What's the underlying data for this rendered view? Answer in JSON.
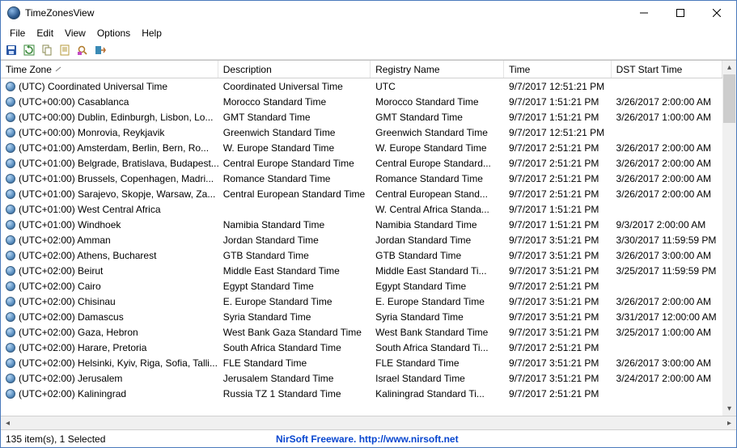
{
  "window": {
    "title": "TimeZonesView"
  },
  "menus": [
    "File",
    "Edit",
    "View",
    "Options",
    "Help"
  ],
  "columns": {
    "tz": "Time Zone",
    "desc": "Description",
    "reg": "Registry Name",
    "time": "Time",
    "dst": "DST Start Time",
    "sort_caret": "∠"
  },
  "rows": [
    {
      "tz": "(UTC) Coordinated Universal Time",
      "desc": "Coordinated Universal Time",
      "reg": "UTC",
      "time": "9/7/2017 12:51:21 PM",
      "dst": ""
    },
    {
      "tz": "(UTC+00:00) Casablanca",
      "desc": "Morocco Standard Time",
      "reg": "Morocco Standard Time",
      "time": "9/7/2017 1:51:21 PM",
      "dst": "3/26/2017 2:00:00 AM"
    },
    {
      "tz": "(UTC+00:00) Dublin, Edinburgh, Lisbon, Lo...",
      "desc": "GMT Standard Time",
      "reg": "GMT Standard Time",
      "time": "9/7/2017 1:51:21 PM",
      "dst": "3/26/2017 1:00:00 AM"
    },
    {
      "tz": "(UTC+00:00) Monrovia, Reykjavik",
      "desc": "Greenwich Standard Time",
      "reg": "Greenwich Standard Time",
      "time": "9/7/2017 12:51:21 PM",
      "dst": ""
    },
    {
      "tz": "(UTC+01:00) Amsterdam, Berlin, Bern, Ro...",
      "desc": "W. Europe Standard Time",
      "reg": "W. Europe Standard Time",
      "time": "9/7/2017 2:51:21 PM",
      "dst": "3/26/2017 2:00:00 AM"
    },
    {
      "tz": "(UTC+01:00) Belgrade, Bratislava, Budapest...",
      "desc": "Central Europe Standard Time",
      "reg": "Central Europe Standard...",
      "time": "9/7/2017 2:51:21 PM",
      "dst": "3/26/2017 2:00:00 AM"
    },
    {
      "tz": "(UTC+01:00) Brussels, Copenhagen, Madri...",
      "desc": "Romance Standard Time",
      "reg": "Romance Standard Time",
      "time": "9/7/2017 2:51:21 PM",
      "dst": "3/26/2017 2:00:00 AM"
    },
    {
      "tz": "(UTC+01:00) Sarajevo, Skopje, Warsaw, Za...",
      "desc": "Central European Standard Time",
      "reg": "Central European Stand...",
      "time": "9/7/2017 2:51:21 PM",
      "dst": "3/26/2017 2:00:00 AM"
    },
    {
      "tz": "(UTC+01:00) West Central Africa",
      "desc": "",
      "reg": "W. Central Africa Standa...",
      "time": "9/7/2017 1:51:21 PM",
      "dst": ""
    },
    {
      "tz": "(UTC+01:00) Windhoek",
      "desc": "Namibia Standard Time",
      "reg": "Namibia Standard Time",
      "time": "9/7/2017 1:51:21 PM",
      "dst": "9/3/2017 2:00:00 AM"
    },
    {
      "tz": "(UTC+02:00) Amman",
      "desc": "Jordan Standard Time",
      "reg": "Jordan Standard Time",
      "time": "9/7/2017 3:51:21 PM",
      "dst": "3/30/2017 11:59:59 PM"
    },
    {
      "tz": "(UTC+02:00) Athens, Bucharest",
      "desc": "GTB Standard Time",
      "reg": "GTB Standard Time",
      "time": "9/7/2017 3:51:21 PM",
      "dst": "3/26/2017 3:00:00 AM"
    },
    {
      "tz": "(UTC+02:00) Beirut",
      "desc": "Middle East Standard Time",
      "reg": "Middle East Standard Ti...",
      "time": "9/7/2017 3:51:21 PM",
      "dst": "3/25/2017 11:59:59 PM"
    },
    {
      "tz": "(UTC+02:00) Cairo",
      "desc": "Egypt Standard Time",
      "reg": "Egypt Standard Time",
      "time": "9/7/2017 2:51:21 PM",
      "dst": ""
    },
    {
      "tz": "(UTC+02:00) Chisinau",
      "desc": "E. Europe Standard Time",
      "reg": "E. Europe Standard Time",
      "time": "9/7/2017 3:51:21 PM",
      "dst": "3/26/2017 2:00:00 AM"
    },
    {
      "tz": "(UTC+02:00) Damascus",
      "desc": "Syria Standard Time",
      "reg": "Syria Standard Time",
      "time": "9/7/2017 3:51:21 PM",
      "dst": "3/31/2017 12:00:00 AM"
    },
    {
      "tz": "(UTC+02:00) Gaza, Hebron",
      "desc": "West Bank Gaza Standard Time",
      "reg": "West Bank Standard Time",
      "time": "9/7/2017 3:51:21 PM",
      "dst": "3/25/2017 1:00:00 AM"
    },
    {
      "tz": "(UTC+02:00) Harare, Pretoria",
      "desc": "South Africa Standard Time",
      "reg": "South Africa Standard Ti...",
      "time": "9/7/2017 2:51:21 PM",
      "dst": ""
    },
    {
      "tz": "(UTC+02:00) Helsinki, Kyiv, Riga, Sofia, Talli...",
      "desc": "FLE Standard Time",
      "reg": "FLE Standard Time",
      "time": "9/7/2017 3:51:21 PM",
      "dst": "3/26/2017 3:00:00 AM"
    },
    {
      "tz": "(UTC+02:00) Jerusalem",
      "desc": "Jerusalem Standard Time",
      "reg": "Israel Standard Time",
      "time": "9/7/2017 3:51:21 PM",
      "dst": "3/24/2017 2:00:00 AM"
    },
    {
      "tz": "(UTC+02:00) Kaliningrad",
      "desc": "Russia TZ 1 Standard Time",
      "reg": "Kaliningrad Standard Ti...",
      "time": "9/7/2017 2:51:21 PM",
      "dst": ""
    }
  ],
  "status": {
    "left": "135 item(s), 1 Selected",
    "right": "NirSoft Freeware.  http://www.nirsoft.net"
  }
}
